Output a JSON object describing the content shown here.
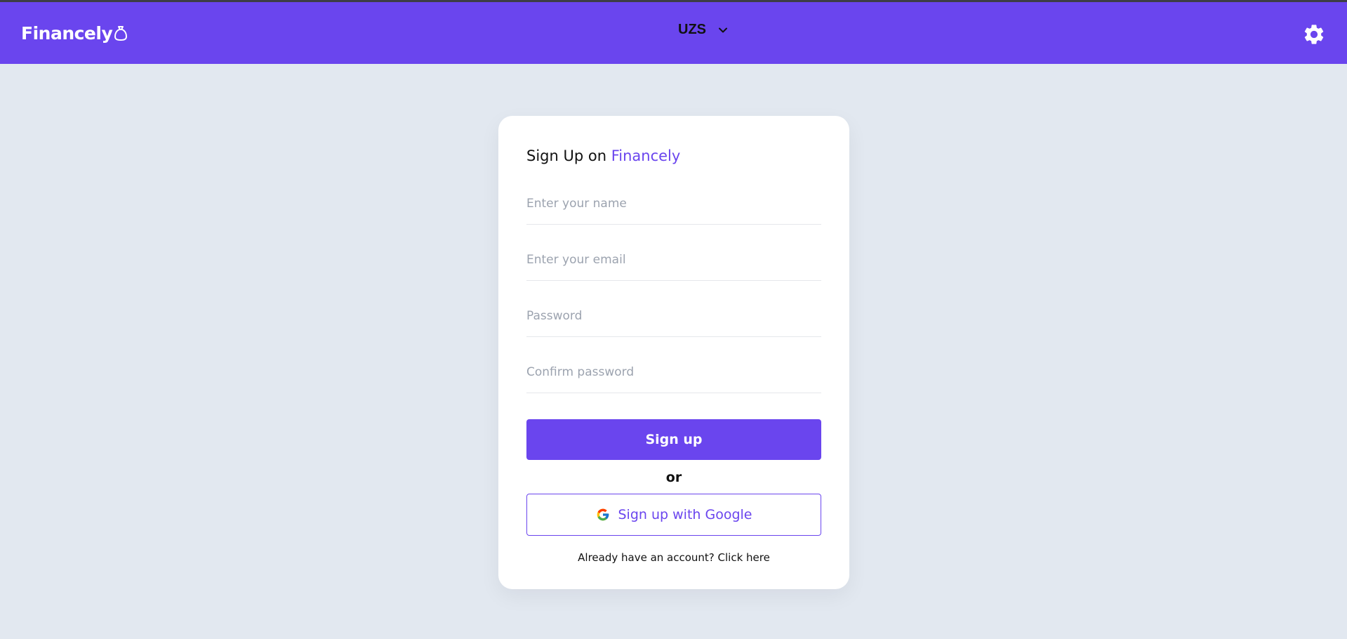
{
  "header": {
    "logo_text": "Financely",
    "logo_icon": "money-bag-icon",
    "currency": {
      "selected": "UZS",
      "icon": "chevron-down-icon"
    },
    "settings_icon": "gear-icon"
  },
  "signup": {
    "title_prefix": "Sign Up on ",
    "title_brand": "Financely",
    "name_placeholder": "Enter your name",
    "email_placeholder": "Enter your email",
    "password_placeholder": "Password",
    "confirm_placeholder": "Confirm password",
    "submit_label": "Sign up",
    "divider_label": "or",
    "google_label": "Sign up with Google",
    "google_icon": "google-icon",
    "login_prompt": "Already have an account? Click here"
  },
  "colors": {
    "accent": "#6a45ee",
    "background": "#e2e8f0",
    "card": "#ffffff"
  }
}
